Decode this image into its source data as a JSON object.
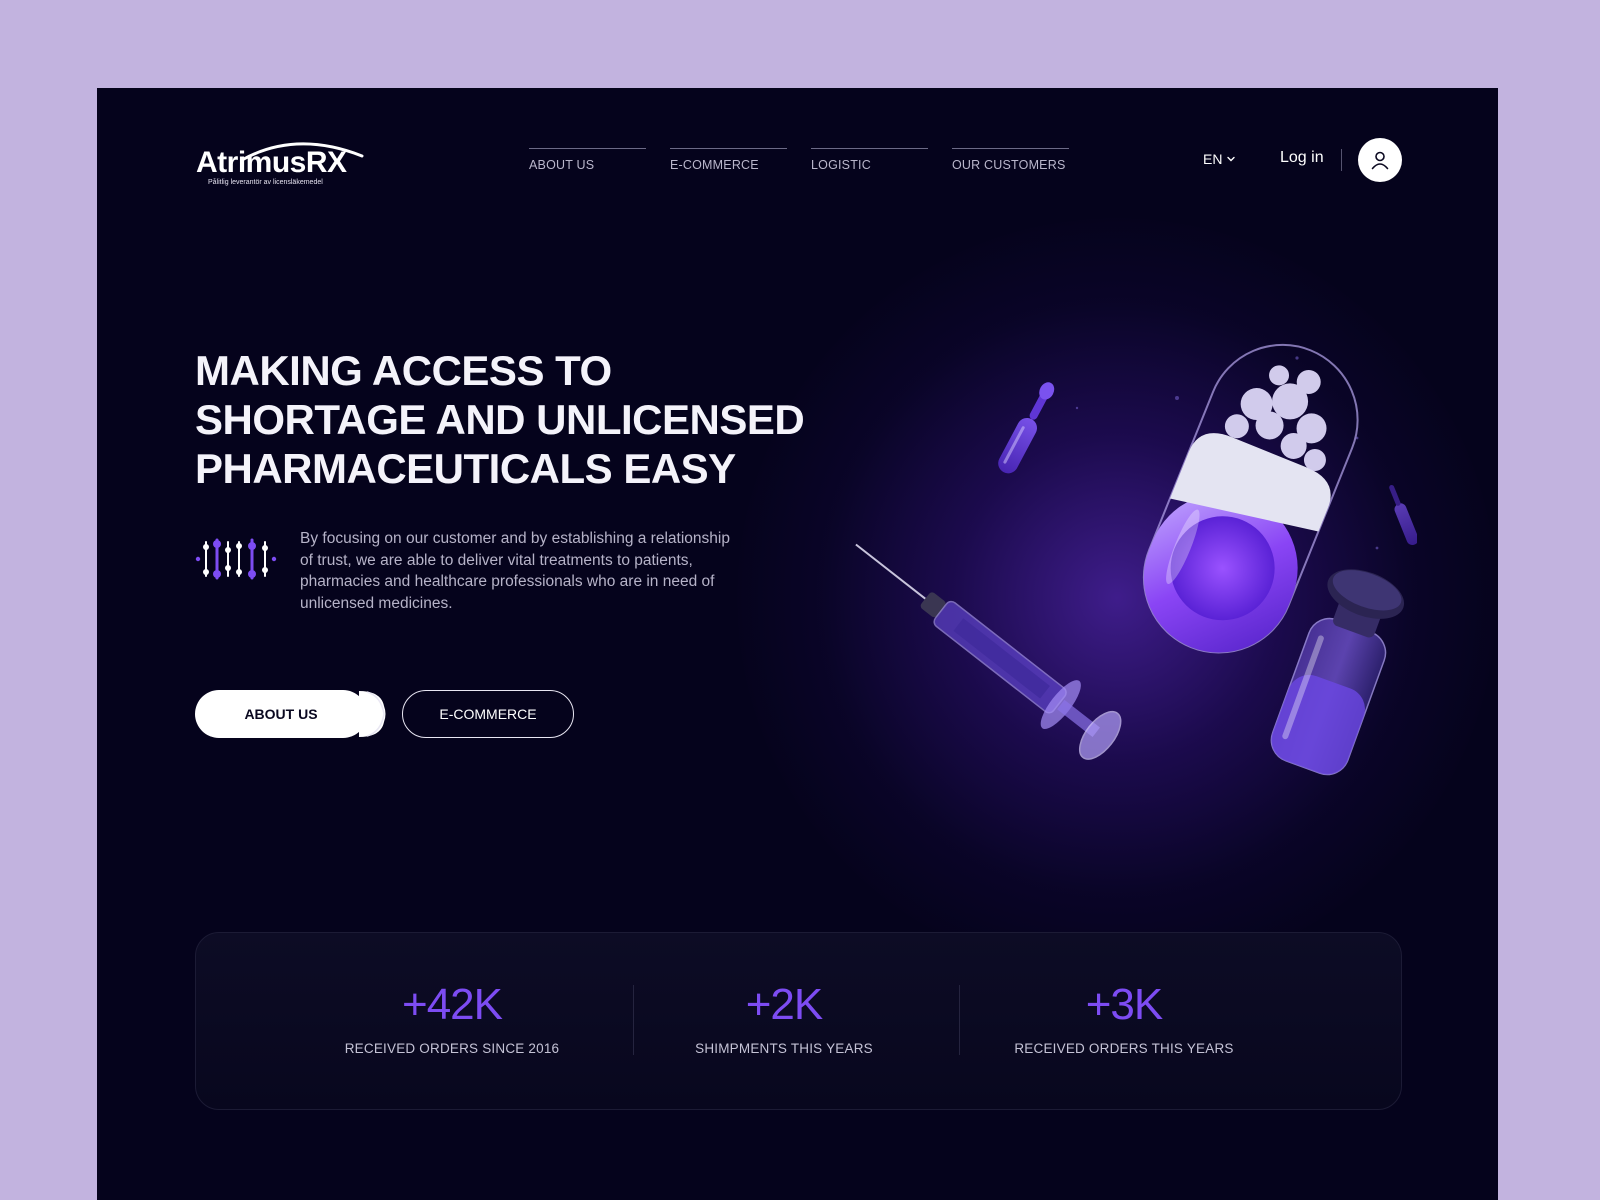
{
  "brand": {
    "name": "AtrimusRX",
    "tagline": "Pålitlig leverantör av licensläkemedel"
  },
  "nav": {
    "items": [
      {
        "label": "ABOUT US"
      },
      {
        "label": "E-COMMERCE"
      },
      {
        "label": "LOGISTIC"
      },
      {
        "label": "OUR CUSTOMERS"
      }
    ]
  },
  "header": {
    "language": "EN",
    "login_label": "Log in",
    "account_icon": "user-icon"
  },
  "hero": {
    "title_lines": [
      "MAKING ACCESS TO",
      "SHORTAGE AND UNLICENSED",
      "PHARMACEUTICALS EASY"
    ],
    "description": "By focusing on our customer and by establishing a relationship of trust, we are able to deliver vital treatments to patients, pharmacies and healthcare professionals who are in need of unlicensed medicines.",
    "primary_button": "ABOUT US",
    "secondary_button": "E-COMMERCE",
    "illustration_icon": "pharma-3d-illustration"
  },
  "stats": [
    {
      "value": "+42K",
      "label": "RECEIVED ORDERS SINCE 2016"
    },
    {
      "value": "+2K",
      "label": "SHIMPMENTS THIS YEARS"
    },
    {
      "value": "+3K",
      "label": "RECEIVED ORDERS THIS YEARS"
    }
  ],
  "colors": {
    "page_bg": "#c2b3df",
    "frame_bg": "#05031c",
    "accent": "#7d4cf3",
    "text_light": "#f4f3fa",
    "text_muted": "#b6b3c8"
  }
}
